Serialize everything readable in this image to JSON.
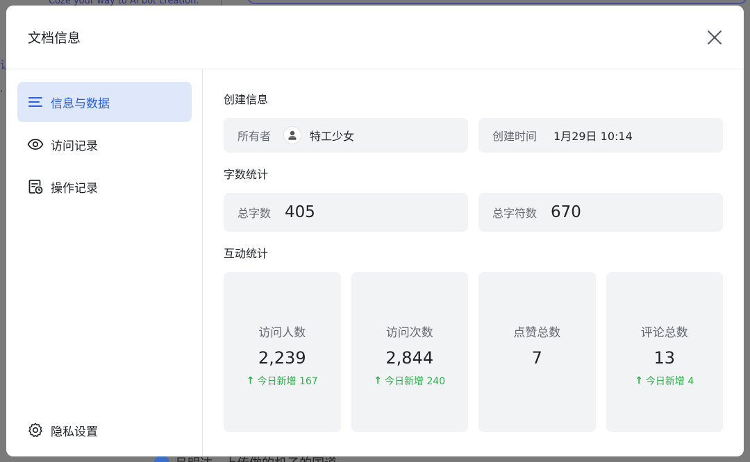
{
  "background": {
    "banner_text": "Coze your way to AI bot creation.",
    "bottom_text": "吕明达 · 上传做的机子的国道"
  },
  "modal": {
    "title": "文档信息",
    "close_icon": "close-icon"
  },
  "sidebar": {
    "items": [
      {
        "label": "信息与数据",
        "icon": "list-icon",
        "active": true
      },
      {
        "label": "访问记录",
        "icon": "eye-icon",
        "active": false
      },
      {
        "label": "操作记录",
        "icon": "document-clock-icon",
        "active": false
      }
    ],
    "privacy": {
      "label": "隐私设置",
      "icon": "gear-icon"
    }
  },
  "create_info": {
    "title": "创建信息",
    "owner_label": "所有者",
    "owner_name": "特工少女",
    "time_label": "创建时间",
    "time_value": "1月29日 10:14"
  },
  "word_stats": {
    "title": "字数统计",
    "words_label": "总字数",
    "words_value": "405",
    "chars_label": "总字符数",
    "chars_value": "670"
  },
  "interaction": {
    "title": "互动统计",
    "cards": [
      {
        "label": "访问人数",
        "value": "2,239",
        "delta": "今日新增 167"
      },
      {
        "label": "访问次数",
        "value": "2,844",
        "delta": "今日新增 240"
      },
      {
        "label": "点赞总数",
        "value": "7",
        "delta": ""
      },
      {
        "label": "评论总数",
        "value": "13",
        "delta": "今日新增 4"
      }
    ]
  },
  "colors": {
    "accent": "#2b5fe0",
    "active_bg": "#dfe7fb",
    "positive": "#2db24b"
  }
}
